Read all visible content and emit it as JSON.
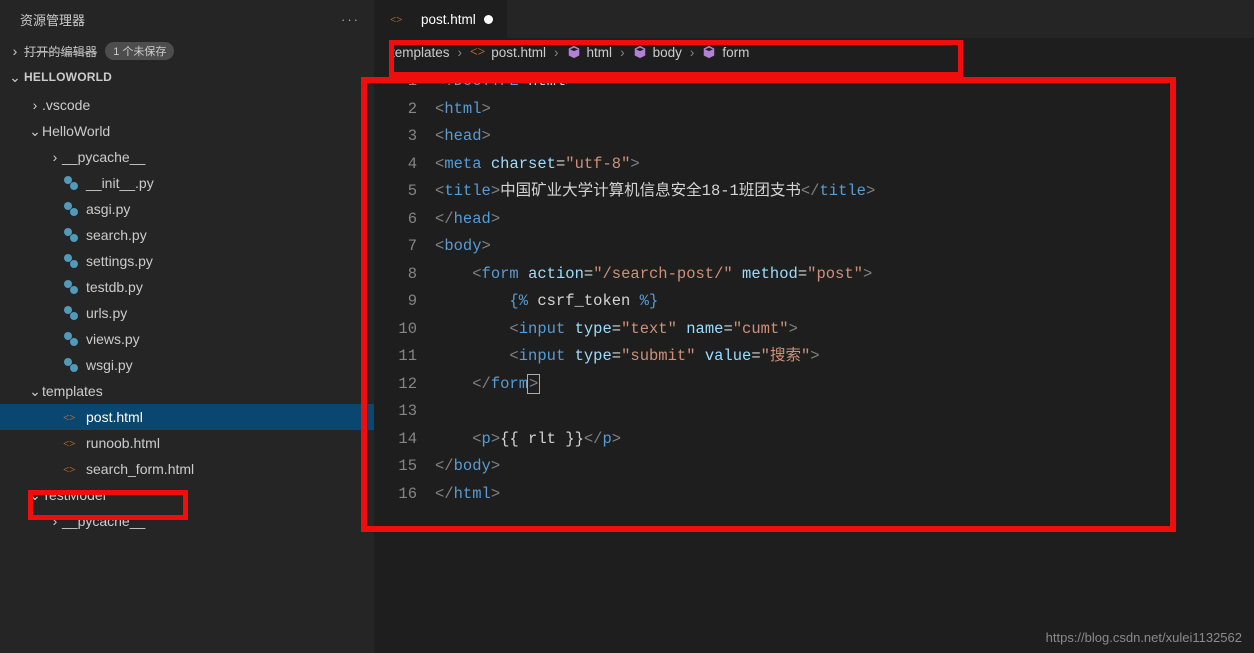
{
  "sidebar": {
    "title": "资源管理器",
    "open_editors": {
      "label": "打开的编辑器",
      "badge": "1 个未保存"
    },
    "project": "HELLOWORLD",
    "tree": [
      {
        "kind": "folder",
        "chev": "›",
        "indent": 28,
        "name": ".vscode"
      },
      {
        "kind": "folder",
        "chev": "⌄",
        "indent": 28,
        "name": "HelloWorld"
      },
      {
        "kind": "folder",
        "chev": "›",
        "indent": 48,
        "name": "__pycache__"
      },
      {
        "kind": "py",
        "chev": "",
        "indent": 48,
        "name": "__init__.py"
      },
      {
        "kind": "py",
        "chev": "",
        "indent": 48,
        "name": "asgi.py"
      },
      {
        "kind": "py",
        "chev": "",
        "indent": 48,
        "name": "search.py"
      },
      {
        "kind": "py",
        "chev": "",
        "indent": 48,
        "name": "settings.py"
      },
      {
        "kind": "py",
        "chev": "",
        "indent": 48,
        "name": "testdb.py"
      },
      {
        "kind": "py",
        "chev": "",
        "indent": 48,
        "name": "urls.py"
      },
      {
        "kind": "py",
        "chev": "",
        "indent": 48,
        "name": "views.py"
      },
      {
        "kind": "py",
        "chev": "",
        "indent": 48,
        "name": "wsgi.py"
      },
      {
        "kind": "folder",
        "chev": "⌄",
        "indent": 28,
        "name": "templates"
      },
      {
        "kind": "html",
        "chev": "",
        "indent": 48,
        "name": "post.html",
        "selected": true
      },
      {
        "kind": "html",
        "chev": "",
        "indent": 48,
        "name": "runoob.html"
      },
      {
        "kind": "html",
        "chev": "",
        "indent": 48,
        "name": "search_form.html"
      },
      {
        "kind": "folder",
        "chev": "⌄",
        "indent": 28,
        "name": "TestModel"
      },
      {
        "kind": "folder",
        "chev": "›",
        "indent": 48,
        "name": "__pycache__"
      }
    ]
  },
  "tab": {
    "filename": "post.html",
    "modified": true
  },
  "breadcrumbs": [
    {
      "icon": "none",
      "label": "templates"
    },
    {
      "icon": "html",
      "label": "post.html"
    },
    {
      "icon": "cube",
      "label": "html"
    },
    {
      "icon": "cube",
      "label": "body"
    },
    {
      "icon": "cube",
      "label": "form"
    }
  ],
  "code": {
    "line_count": 16,
    "cursor_line": 12
  },
  "watermark": "https://blog.csdn.net/xulei1132562"
}
